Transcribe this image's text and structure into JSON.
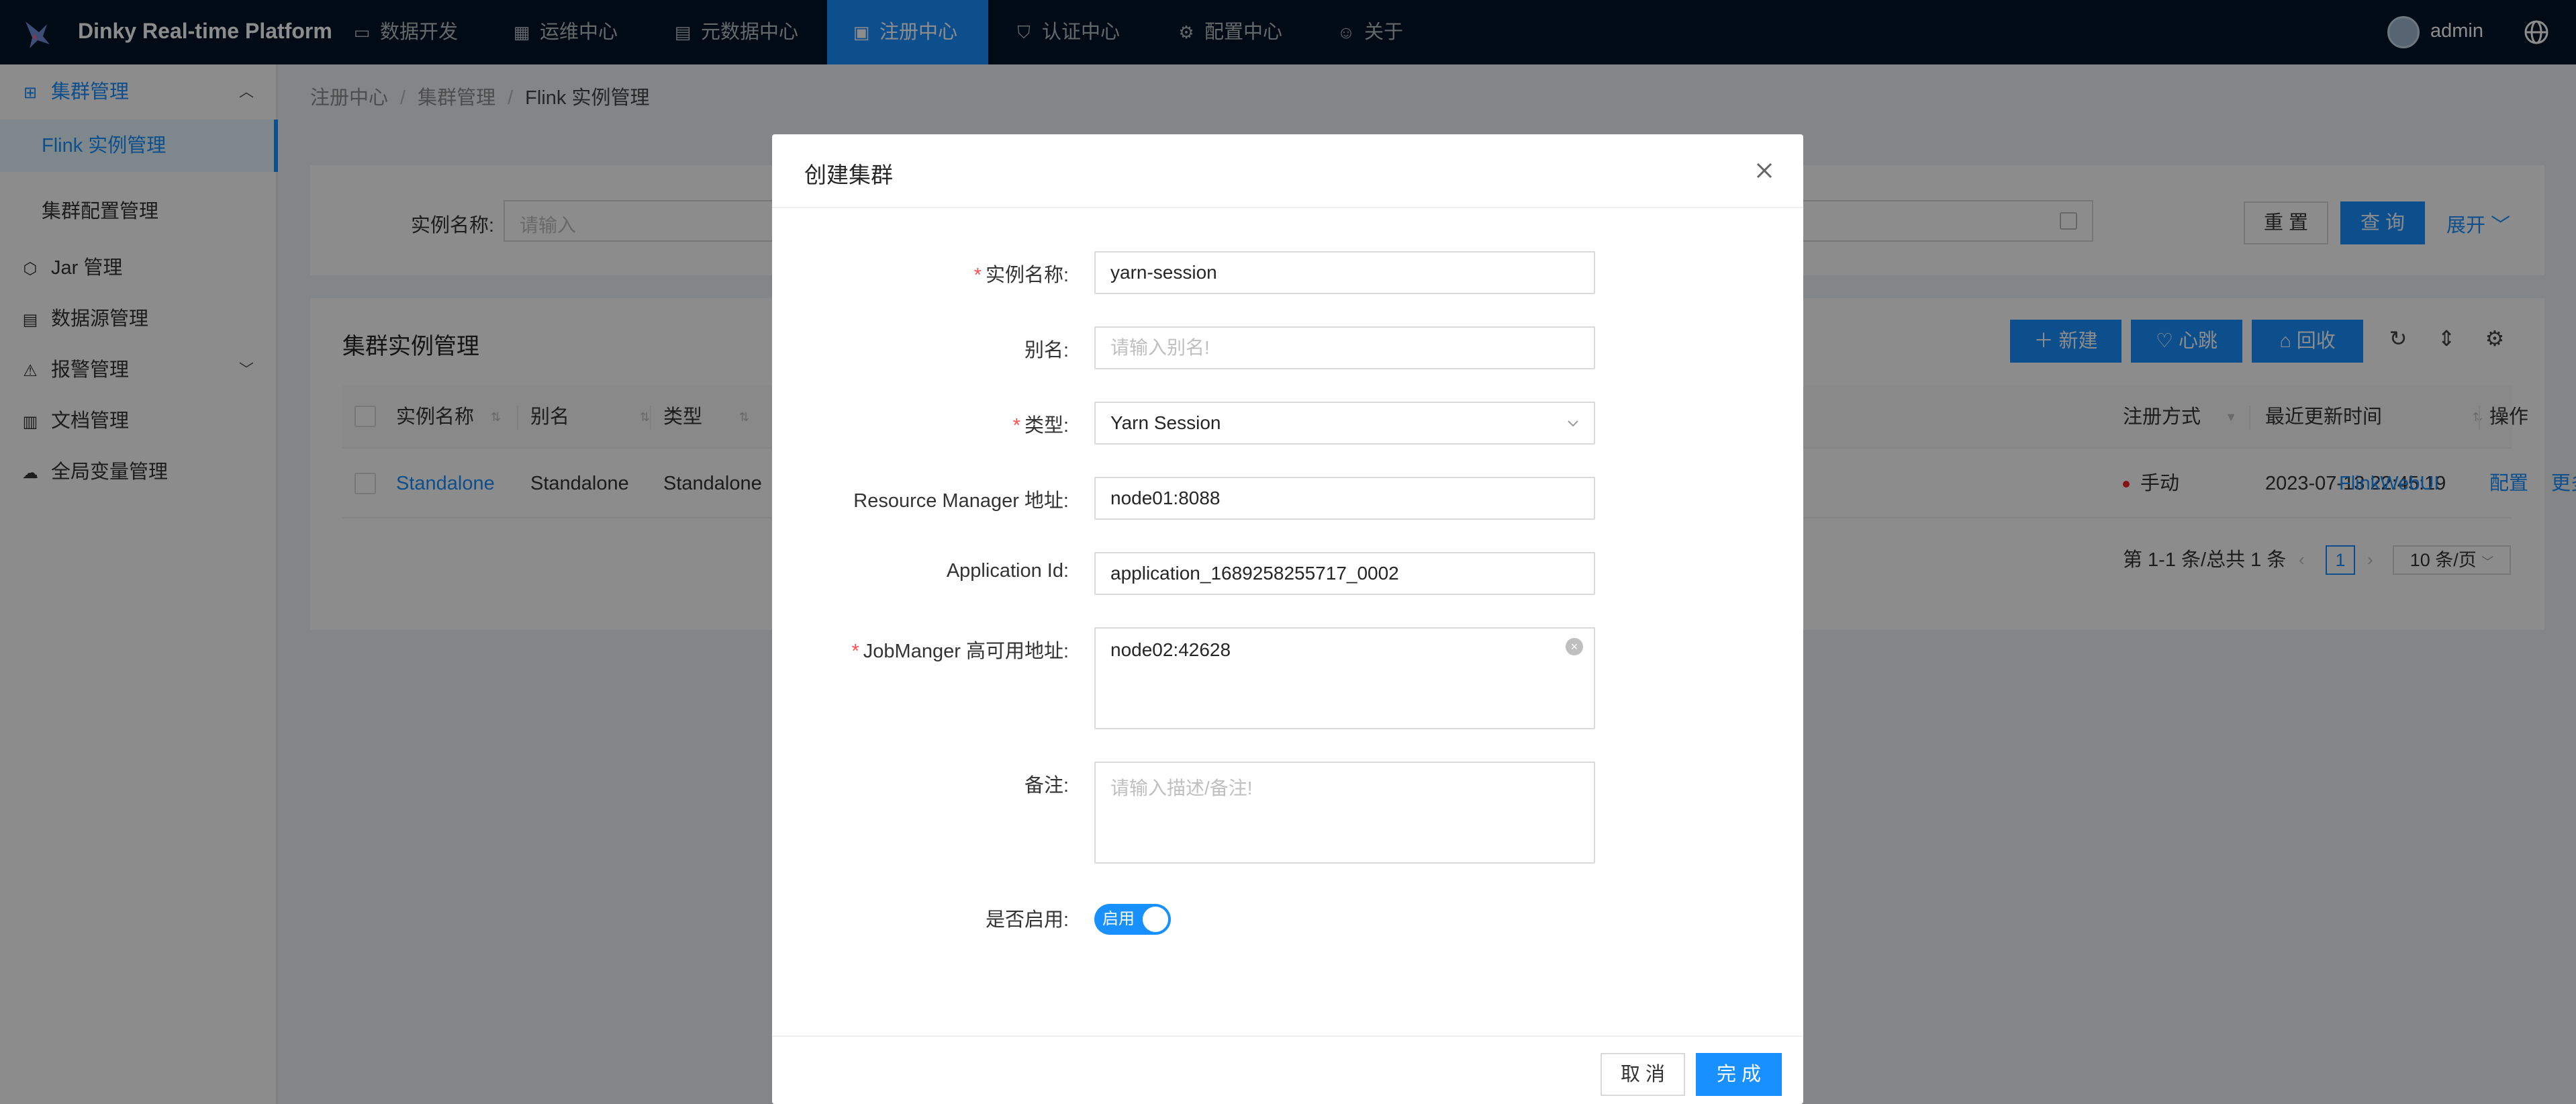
{
  "app": {
    "brand": "Dinky Real-time Platform",
    "user": "admin"
  },
  "nav": [
    {
      "label": "数据开发",
      "icon": "monitor-icon"
    },
    {
      "label": "运维中心",
      "icon": "dashboard-icon"
    },
    {
      "label": "元数据中心",
      "icon": "database-icon"
    },
    {
      "label": "注册中心",
      "icon": "grid-icon",
      "active": true
    },
    {
      "label": "认证中心",
      "icon": "shield-icon"
    },
    {
      "label": "配置中心",
      "icon": "settings-icon"
    },
    {
      "label": "关于",
      "icon": "smile-icon"
    }
  ],
  "sidebar": {
    "cluster_group": "集群管理",
    "flink_instance": "Flink 实例管理",
    "cluster_config": "集群配置管理",
    "jar": "Jar 管理",
    "datasource": "数据源管理",
    "alert": "报警管理",
    "docs": "文档管理",
    "globalvar": "全局变量管理"
  },
  "breadcrumb": {
    "root": "注册中心",
    "parent": "集群管理",
    "current": "Flink 实例管理",
    "sep": "/"
  },
  "search": {
    "label": "实例名称:",
    "placeholder": "请输入",
    "reset": "重 置",
    "query": "查 询",
    "expand": "展开"
  },
  "table": {
    "title": "集群实例管理",
    "new_btn": "新建",
    "heartbeat_btn": "心跳",
    "recycle_btn": "回收",
    "headers": {
      "name": "实例名称",
      "alias": "别名",
      "type": "类型",
      "register": "注册方式",
      "updated": "最近更新时间",
      "ops": "操作"
    },
    "row": {
      "name": "Standalone",
      "alias": "Standalone",
      "type": "Standalone",
      "register": "手动",
      "updated": "2023-07-13 22:45:19",
      "config": "配置",
      "more": "更多",
      "webui": "FlinkWebUI"
    },
    "pager": {
      "summary": "第 1-1 条/总共 1 条",
      "page": "1",
      "size": "10 条/页"
    }
  },
  "modal": {
    "title": "创建集群",
    "fields": {
      "name_label": "实例名称:",
      "name_value": "yarn-session",
      "alias_label": "别名:",
      "alias_placeholder": "请输入别名!",
      "type_label": "类型:",
      "type_value": "Yarn Session",
      "rm_label": "Resource Manager 地址:",
      "rm_value": "node01:8088",
      "appid_label": "Application Id:",
      "appid_value": "application_1689258255717_0002",
      "jm_label": "JobManger 高可用地址:",
      "jm_value": "node02:42628",
      "note_label": "备注:",
      "note_placeholder": "请输入描述/备注!",
      "enable_label": "是否启用:",
      "enable_value": "启用"
    },
    "cancel": "取 消",
    "ok": "完 成"
  },
  "colors": {
    "primary": "#1890ff",
    "nav_bg": "#001529",
    "required": "#ff4d4f"
  }
}
